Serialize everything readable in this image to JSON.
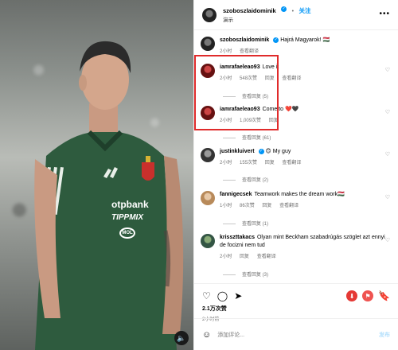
{
  "post": {
    "author": "szoboszlaidominik",
    "follow_label": "关注",
    "location": "演示",
    "caption_user": "szoboszlaidominik",
    "caption_text": "Hajrá Magyarok! 🇭🇺",
    "caption_time": "2小时",
    "caption_translate": "查看翻译"
  },
  "comments": [
    {
      "user": "iamrafaeleao93",
      "text": "Love it",
      "time": "2小时",
      "likes": "548次赞",
      "reply": "回复",
      "translate": "查看翻译",
      "replies": "查看回复 (5)"
    },
    {
      "user": "iamrafaeleao93",
      "text": "Come to ❤️🖤",
      "time": "2小时",
      "likes": "1,009次赞",
      "reply": "回复",
      "translate": "",
      "replies": "查看回复 (61)"
    },
    {
      "user": "justinkluivert",
      "text": "😊 My guy",
      "time": "2小时",
      "likes": "155次赞",
      "reply": "回复",
      "translate": "查看翻译",
      "replies": "查看回复 (2)"
    },
    {
      "user": "fannigecsek",
      "text": "Teamwork makes the dream work🇭🇺",
      "time": "1小时",
      "likes": "86次赞",
      "reply": "回复",
      "translate": "查看翻译",
      "replies": "查看回复 (1)"
    },
    {
      "user": "krisszttakacs",
      "text": "Olyan mint Beckham szabadrúgás szöglet azt ennyi de focizni nem tud",
      "time": "2小时",
      "likes": "",
      "reply": "回复",
      "translate": "查看翻译",
      "replies": "查看回复 (3)"
    }
  ],
  "actions": {
    "like_count": "2.1万次赞",
    "time": "2小时前"
  },
  "composer": {
    "placeholder": "添加评论...",
    "post_label": "发布"
  },
  "jersey": {
    "sponsor1": "otpbank",
    "sponsor2": "TIPPMIX",
    "sponsor3": "MOL"
  },
  "colors": {
    "accent": "#0095f6",
    "highlight": "#e02b2b",
    "jersey": "#2e5b3e"
  }
}
